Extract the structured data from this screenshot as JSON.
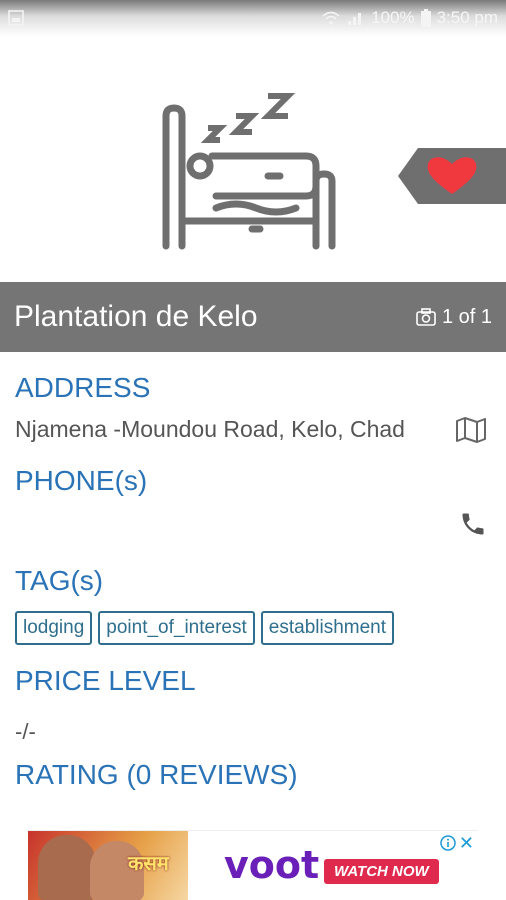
{
  "status_bar": {
    "battery": "100%",
    "time": "3:50 pm"
  },
  "place": {
    "title": "Plantation de Kelo",
    "photo_counter": "1 of 1"
  },
  "address": {
    "heading": "ADDRESS",
    "value": "Njamena -Moundou Road, Kelo, Chad"
  },
  "phone": {
    "heading": "PHONE(s)"
  },
  "tags": {
    "heading": "TAG(s)",
    "items": [
      "lodging",
      "point_of_interest",
      "establishment"
    ]
  },
  "price": {
    "heading": "PRICE LEVEL",
    "value": "-/-"
  },
  "rating": {
    "heading": "RATING (0 REVIEWS)"
  },
  "ad": {
    "show_name": "कसम",
    "brand": "voot",
    "cta": "WATCH NOW",
    "close": "✕"
  },
  "colors": {
    "accent": "#2a73b7",
    "title_bar": "#757575",
    "tag_border": "#2f6f8d",
    "heart": "#f0393f"
  }
}
